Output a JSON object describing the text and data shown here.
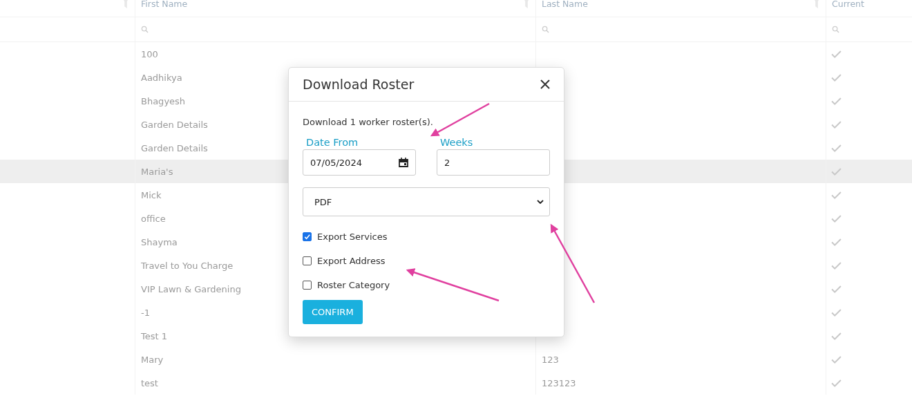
{
  "table": {
    "columns": [
      {
        "label": "First Name"
      },
      {
        "label": "Last Name"
      },
      {
        "label": "Current"
      }
    ],
    "rows": [
      {
        "first_name": "100",
        "current": true,
        "selected": false
      },
      {
        "first_name": "Aadhikya",
        "current": true,
        "selected": false
      },
      {
        "first_name": "Bhagyesh",
        "current": true,
        "selected": false
      },
      {
        "first_name": "Garden Details",
        "current": true,
        "selected": false
      },
      {
        "first_name": "Garden Details",
        "current": true,
        "selected": false
      },
      {
        "first_name": "Maria's",
        "current": true,
        "selected": true
      },
      {
        "first_name": "Mick",
        "current": true,
        "selected": false
      },
      {
        "first_name": "office",
        "current": true,
        "selected": false
      },
      {
        "first_name": "Shayma",
        "current": true,
        "selected": false
      },
      {
        "first_name": "Travel to You Charge",
        "current": true,
        "selected": false
      },
      {
        "first_name": "VIP Lawn & Gardening",
        "current": true,
        "selected": false
      },
      {
        "first_name": "-1",
        "current": true,
        "selected": false
      },
      {
        "first_name": "Test 1",
        "current": true,
        "selected": false
      },
      {
        "first_name": "Mary",
        "last_name": "123",
        "current": true,
        "selected": false
      },
      {
        "first_name": "test",
        "last_name": "123123",
        "current": true,
        "selected": false
      }
    ]
  },
  "dialog": {
    "title": "Download Roster",
    "message": "Download 1 worker roster(s).",
    "date_from": {
      "label": "Date From",
      "value": "07/05/2024"
    },
    "weeks": {
      "label": "Weeks",
      "value": "2"
    },
    "format": {
      "value": "PDF"
    },
    "options": [
      {
        "label": "Export Services",
        "checked": true
      },
      {
        "label": "Export Address",
        "checked": false
      },
      {
        "label": "Roster Category",
        "checked": false
      }
    ],
    "confirm": "CONFIRM"
  }
}
